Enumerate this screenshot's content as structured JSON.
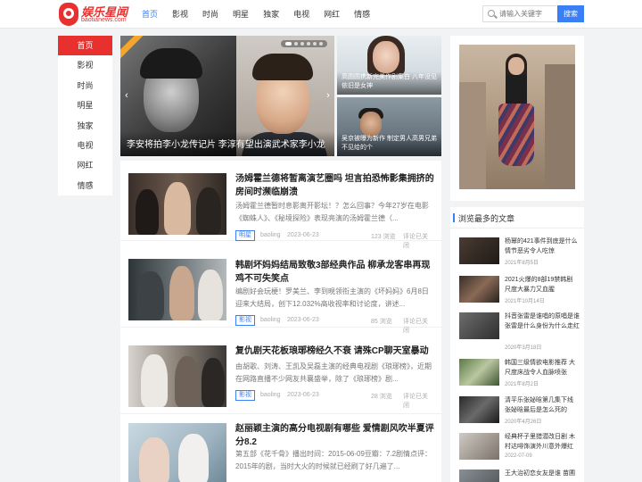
{
  "header": {
    "logo_title": "娱乐星闻",
    "logo_url": "baotianews.com",
    "nav": [
      "首页",
      "影视",
      "时尚",
      "明星",
      "独家",
      "电视",
      "网红",
      "情感"
    ],
    "active_nav": "首页",
    "search": {
      "placeholder": "请输入关键字",
      "button": "搜索"
    }
  },
  "sidebar": {
    "items": [
      "首页",
      "影视",
      "时尚",
      "明星",
      "独家",
      "电视",
      "网红",
      "情感"
    ]
  },
  "slider": {
    "title": "李安将拍李小龙传记片 李淳有望出演武术家李小龙",
    "prev": "‹",
    "next": "›",
    "slide_count": 6
  },
  "side_pics": [
    {
      "title": "高圆圆携新完美作剧集白 八年没见依旧是女神"
    },
    {
      "title": "吴京被曝为新作 制定男人高男兄弟不见给的个"
    }
  ],
  "articles": [
    {
      "title": "汤姆霍兰德将暂离演艺圈吗 坦言拍恐怖影集拥挤的房间时濒临崩溃",
      "desc": "汤姆霍兰德暂时息影离开影坛！？怎么回事？今年27岁在电影《蜘蛛人》、《秘境探险》表现亮演的汤姆霍兰德（...",
      "tag": "明星",
      "author": "baoling",
      "date": "2023-06-23",
      "views": "123 浏览",
      "comments": "评论已关闭"
    },
    {
      "title": "韩剧坏妈妈结局致敬3部经典作品 柳承龙客串再现鸡不可失笑点",
      "desc": "编剧好会玩梗！罗美兰、李到晛领衔主演的《坏妈妈》6月8日迎来大结局，创下12.032%高收视率和讨论度，讲述...",
      "tag": "影视",
      "author": "baoling",
      "date": "2023-06-23",
      "views": "85 浏览",
      "comments": "评论已关闭"
    },
    {
      "title": "复仇剧天花板琅琊榜经久不衰 请殊CP聊天室暴动",
      "desc": "由胡歌、刘涛、王凯及吴磊主演的经典电视剧《琅琊榜》，近期在网路直播不少网友共襄盛举，除了《琅琊榜》剧...",
      "tag": "影视",
      "author": "baoling",
      "date": "2023-06-23",
      "views": "28 浏览",
      "comments": "评论已关闭"
    },
    {
      "title": "赵丽颖主演的高分电视剧有哪些 爱情剧风吹半夏评分8.2",
      "desc": "第五部《花千骨》播出时间：2015-06-09豆瓣：7.2剧情点评：2015年的剧，当时大火的时候就已经刷了好几遍了..."
    }
  ],
  "hot": {
    "title": "浏览最多的文章",
    "items": [
      {
        "title": "杨幂的421事件到底是什么 情节恶劣令人吃惊",
        "date": "2021年8月5日"
      },
      {
        "title": "2021火爆的8部19禁韩剧 尺度大暴力又血腥",
        "date": "2021年10月14日"
      },
      {
        "title": "抖音张雷是谁唱的原唱是谁 张雷是什么身份为什么走红",
        "date": "2020年3月18日"
      },
      {
        "title": "韩国三级情欲电影推荐 大尺度床战令人血脉喷张",
        "date": "2021年8月2日"
      },
      {
        "title": "清平乐张妼晗第几集下线 张妼晗最后是怎么死的",
        "date": "2020年4月26日"
      },
      {
        "title": "经典杯子里猎潜改日剧 木村达啡饰演外川意外爆红",
        "date": "2022-07-09"
      },
      {
        "title": "王大治初恋女友是谁 苗圃"
      }
    ]
  },
  "colors": {
    "accent_blue": "#3b7ff5",
    "brand_red": "#e8312f",
    "page_bg": "#f2f3f5"
  }
}
